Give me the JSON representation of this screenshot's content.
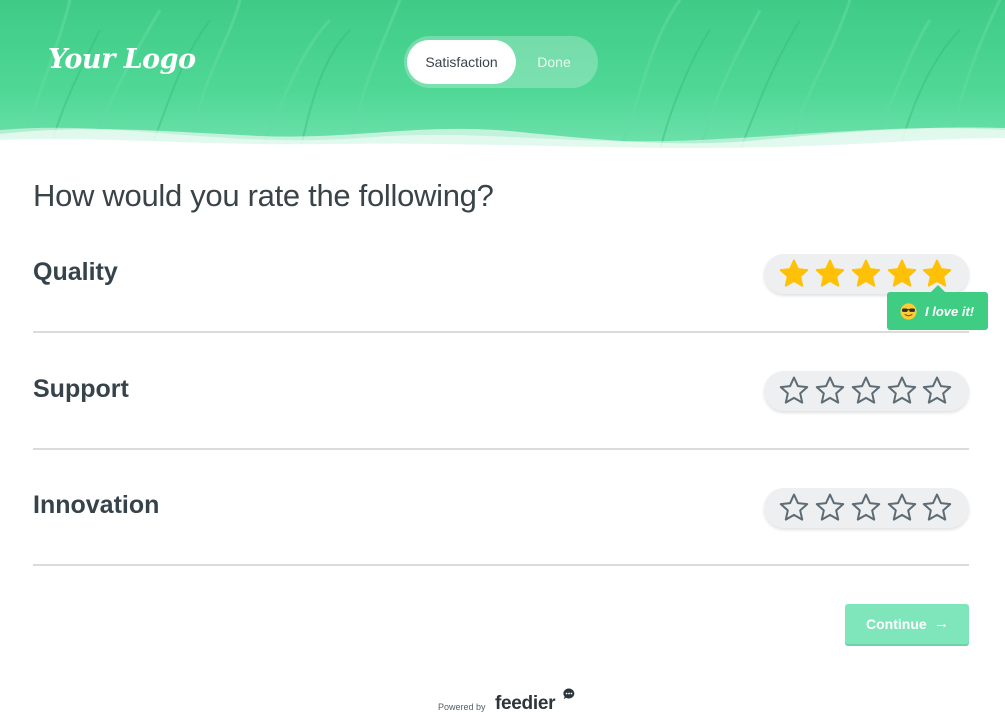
{
  "header": {
    "logo_text": "Your Logo",
    "steps": [
      {
        "label": "Satisfaction",
        "active": true
      },
      {
        "label": "Done",
        "active": false
      }
    ]
  },
  "survey": {
    "question": "How would you rate the following?",
    "items": [
      {
        "label": "Quality",
        "rating": 5,
        "max": 5
      },
      {
        "label": "Support",
        "rating": 0,
        "max": 5
      },
      {
        "label": "Innovation",
        "rating": 0,
        "max": 5
      }
    ],
    "tooltip": {
      "text": "I love it!",
      "icon": "sunglasses-emoji-icon"
    }
  },
  "actions": {
    "continue_label": "Continue",
    "continue_icon": "arrow-right-icon"
  },
  "footer": {
    "powered_by": "Powered by",
    "brand": "feedier"
  },
  "colors": {
    "accent": "#3ecd82",
    "star_filled": "#ffc107",
    "star_empty": "#5d6b75",
    "button": "#7fe6bb"
  }
}
